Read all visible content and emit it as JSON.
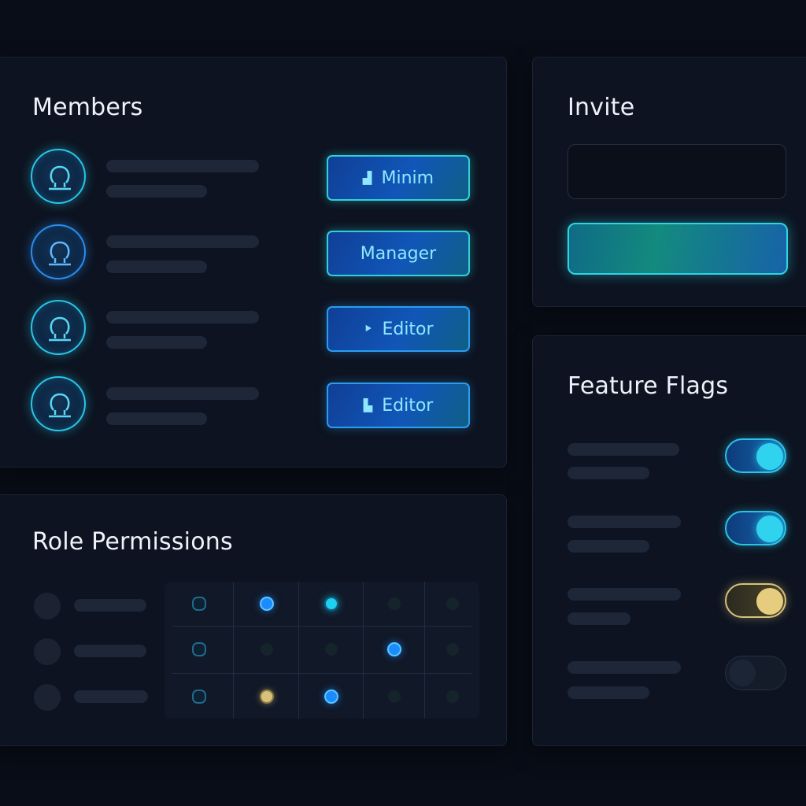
{
  "members": {
    "title": "Members",
    "items": [
      {
        "role_label": "Minim",
        "role_icon": "lock-icon",
        "role_glyph": "▟",
        "avatar_color": "#28c6e8"
      },
      {
        "role_label": "Manager",
        "role_icon": "",
        "role_glyph": "",
        "avatar_color": "#2a8df0"
      },
      {
        "role_label": "Editor",
        "role_icon": "edit-icon",
        "role_glyph": "⯈",
        "avatar_color": "#28c6e8"
      },
      {
        "role_label": "Editor",
        "role_icon": "stamp-icon",
        "role_glyph": "▙",
        "avatar_color": "#28c6e8"
      }
    ]
  },
  "invite": {
    "title": "Invite",
    "input_value": "",
    "input_placeholder": ""
  },
  "permissions": {
    "title": "Role Permissions",
    "grid": [
      [
        "ring-dim",
        "blue",
        "cyan",
        "dim",
        "dim"
      ],
      [
        "ring-dim",
        "dim",
        "dim",
        "blue",
        "dim"
      ],
      [
        "ring-dim",
        "gold",
        "blue",
        "dim",
        "dim"
      ]
    ]
  },
  "flags": {
    "title": "Feature Flags",
    "items": [
      {
        "state": "on",
        "color": "#2fd3ee"
      },
      {
        "state": "on",
        "color": "#2fd3ee"
      },
      {
        "state": "on",
        "color": "#e6cc7e"
      },
      {
        "state": "off",
        "color": "#1c2536"
      }
    ]
  },
  "colors": {
    "background": "#090d17",
    "accent_cyan": "#2fd3ee",
    "accent_blue": "#1a8cff",
    "accent_gold": "#e6cc7e"
  }
}
